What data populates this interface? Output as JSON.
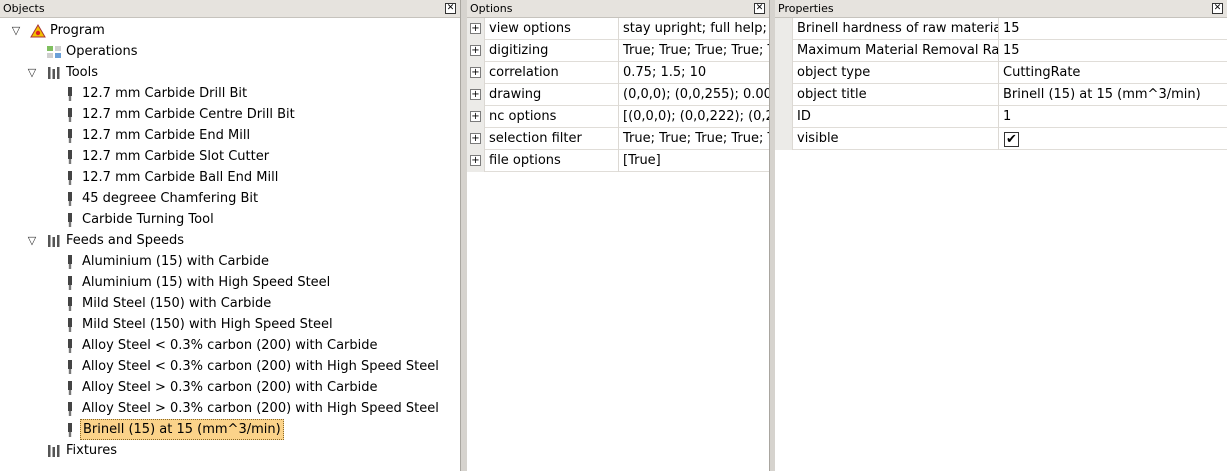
{
  "objects_panel": {
    "title": "Objects",
    "close": "✕",
    "tree": [
      {
        "level": 0,
        "expanded": true,
        "label": "Program",
        "icon": "program-icon"
      },
      {
        "level": 1,
        "expanded": null,
        "label": "Operations",
        "icon": "operations-icon"
      },
      {
        "level": 1,
        "expanded": true,
        "label": "Tools",
        "icon": "tools-icon"
      },
      {
        "level": 2,
        "label": "12.7 mm Carbide Drill Bit",
        "icon": "tool-icon"
      },
      {
        "level": 2,
        "label": "12.7 mm Carbide Centre Drill Bit",
        "icon": "tool-icon"
      },
      {
        "level": 2,
        "label": "12.7 mm Carbide End Mill",
        "icon": "tool-icon"
      },
      {
        "level": 2,
        "label": "12.7 mm Carbide Slot Cutter",
        "icon": "tool-icon"
      },
      {
        "level": 2,
        "label": "12.7 mm Carbide Ball End Mill",
        "icon": "tool-icon"
      },
      {
        "level": 2,
        "label": "45 degreee Chamfering Bit",
        "icon": "tool-icon"
      },
      {
        "level": 2,
        "label": "Carbide Turning Tool",
        "icon": "tool-icon"
      },
      {
        "level": 1,
        "expanded": true,
        "label": "Feeds and Speeds",
        "icon": "tools-icon"
      },
      {
        "level": 2,
        "label": "Aluminium (15) with Carbide",
        "icon": "tool-icon"
      },
      {
        "level": 2,
        "label": "Aluminium (15) with High Speed Steel",
        "icon": "tool-icon"
      },
      {
        "level": 2,
        "label": "Mild Steel (150) with Carbide",
        "icon": "tool-icon"
      },
      {
        "level": 2,
        "label": "Mild Steel (150) with High Speed Steel",
        "icon": "tool-icon"
      },
      {
        "level": 2,
        "label": "Alloy Steel < 0.3% carbon (200) with Carbide",
        "icon": "tool-icon"
      },
      {
        "level": 2,
        "label": "Alloy Steel < 0.3% carbon (200) with High Speed Steel",
        "icon": "tool-icon"
      },
      {
        "level": 2,
        "label": "Alloy Steel > 0.3% carbon (200) with Carbide",
        "icon": "tool-icon"
      },
      {
        "level": 2,
        "label": "Alloy Steel > 0.3% carbon (200) with High Speed Steel",
        "icon": "tool-icon"
      },
      {
        "level": 2,
        "label": "Brinell (15) at 15 (mm^3/min)",
        "icon": "tool-icon",
        "selected": true
      },
      {
        "level": 1,
        "expanded": null,
        "label": "Fixtures",
        "icon": "tools-icon"
      }
    ]
  },
  "options_panel": {
    "title": "Options",
    "close": "✕",
    "rows": [
      {
        "name": "view options",
        "value": "stay upright; full help;"
      },
      {
        "name": "digitizing",
        "value": "True; True; True; True; T"
      },
      {
        "name": "correlation",
        "value": "0.75; 1.5; 10"
      },
      {
        "name": "drawing",
        "value": "(0,0,0); (0,0,255); 0.00"
      },
      {
        "name": "nc options",
        "value": "[(0,0,0); (0,0,222); (0,2"
      },
      {
        "name": "selection filter",
        "value": "True; True; True; True; T"
      },
      {
        "name": "file options",
        "value": "[True]"
      }
    ]
  },
  "properties_panel": {
    "title": "Properties",
    "close": "✕",
    "rows": [
      {
        "name": "Brinell hardness of raw material",
        "value": "15"
      },
      {
        "name": "Maximum Material Removal Rate",
        "value": "15"
      },
      {
        "name": "object type",
        "value": "CuttingRate"
      },
      {
        "name": "object title",
        "value": "Brinell (15) at 15 (mm^3/min)"
      },
      {
        "name": "ID",
        "value": "1"
      },
      {
        "name": "visible",
        "value": "",
        "checkbox": true,
        "checked": true,
        "check_glyph": "✔"
      }
    ]
  }
}
